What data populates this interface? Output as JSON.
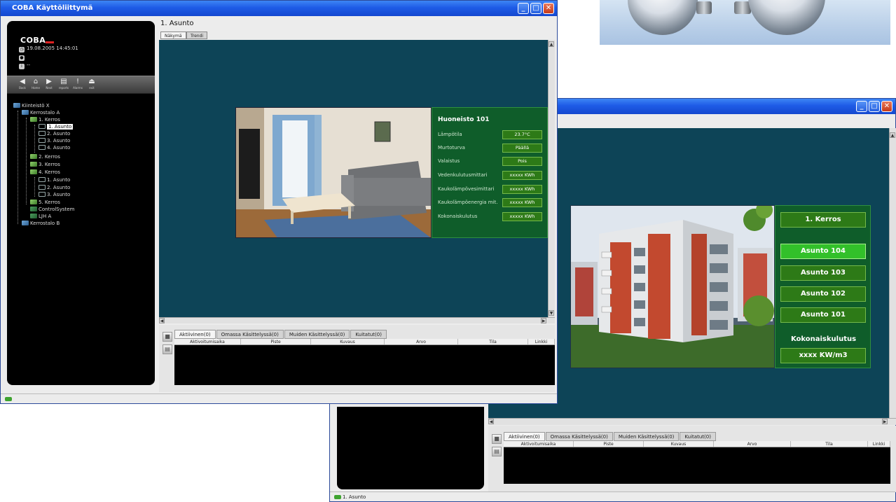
{
  "front_window": {
    "title": "COBA Käyttöliittymä",
    "logo": "COBA",
    "datetime": "19.08.2005 14:45:01",
    "user": "",
    "info": "--",
    "nav": [
      {
        "icon": "back-icon",
        "label": "Back"
      },
      {
        "icon": "home-icon",
        "label": "Home"
      },
      {
        "icon": "next-icon",
        "label": "Next"
      },
      {
        "icon": "reports-icon",
        "label": "reports"
      },
      {
        "icon": "alarms-icon",
        "label": "Alarms"
      },
      {
        "icon": "exit-icon",
        "label": "exit"
      }
    ],
    "tree": [
      {
        "label": "Kiinteistö X",
        "icon": "home"
      },
      {
        "label": "Kerrostalo A",
        "icon": "home"
      },
      {
        "label": "1. Kerros",
        "icon": "folder"
      },
      {
        "label": "1. Asunto",
        "icon": "doc",
        "selected": true
      },
      {
        "label": "2. Asunto",
        "icon": "doc"
      },
      {
        "label": "3. Asunto",
        "icon": "doc"
      },
      {
        "label": "4. Asunto",
        "icon": "doc"
      },
      {
        "label": "2. Kerros",
        "icon": "folder"
      },
      {
        "label": "3. Kerros",
        "icon": "folder"
      },
      {
        "label": "4. Kerros",
        "icon": "folder"
      },
      {
        "label": "1. Asunto",
        "icon": "doc"
      },
      {
        "label": "2. Asunto",
        "icon": "doc"
      },
      {
        "label": "3. Asunto",
        "icon": "doc"
      },
      {
        "label": "5. Kerros",
        "icon": "folder"
      },
      {
        "label": "ControlSystem",
        "icon": "sys"
      },
      {
        "label": "LJH A",
        "icon": "sys"
      },
      {
        "label": "Kerrostalo B",
        "icon": "home"
      }
    ],
    "scene_title": "1. Asunto",
    "scene_tabs": [
      "Näkymä",
      "Trendi"
    ],
    "room": {
      "title": "Huoneisto 101",
      "rows": [
        {
          "label": "Lämpötila",
          "value": "23.7°C"
        },
        {
          "label": "Murtoturva",
          "value": "Päällä"
        },
        {
          "label": "Valaistus",
          "value": "Pois"
        },
        {
          "label": "Vedenkulutusmittari",
          "value": "xxxxx KWh"
        },
        {
          "label": "Kaukolämpövesimittari",
          "value": "xxxxx KWh"
        },
        {
          "label": "Kaukolämpöenergia mit.",
          "value": "xxxxx KWh"
        },
        {
          "label": "Kokonaiskulutus",
          "value": "xxxxx KWh"
        }
      ]
    },
    "alarm_tabs": [
      "Aktiivinen(0)",
      "Omassa Käsittelyssä(0)",
      "Muiden Käsittelyssä(0)",
      "Kuitatut(0)"
    ],
    "alarm_columns": [
      "Aktivoitumisaika",
      "Piste",
      "Kuvaus",
      "Arvo",
      "Tila",
      "Linkki"
    ]
  },
  "back_window": {
    "floor_button": "1. Kerros",
    "apartments": [
      {
        "label": "Asunto 104",
        "active": true
      },
      {
        "label": "Asunto 103",
        "active": false
      },
      {
        "label": "Asunto 102",
        "active": false
      },
      {
        "label": "Asunto 101",
        "active": false
      }
    ],
    "kokonais_label": "Kokonaiskulutus",
    "kokonais_value": "xxxx KW/m3",
    "alarm_tabs": [
      "Aktiivinen(0)",
      "Omassa Käsittelyssä(0)",
      "Muiden Käsittelyssä(0)",
      "Kuitatut(0)"
    ],
    "alarm_columns": [
      "Aktivoitumisaika",
      "Piste",
      "Kuvaus",
      "Arvo",
      "Tila",
      "Linkki"
    ],
    "status": "1. Asunto"
  },
  "colors": {
    "scene_bg": "#0d4457",
    "panel_green": "#0f5d2a",
    "value_green": "#2d7a17",
    "active_green": "#32c02a"
  }
}
